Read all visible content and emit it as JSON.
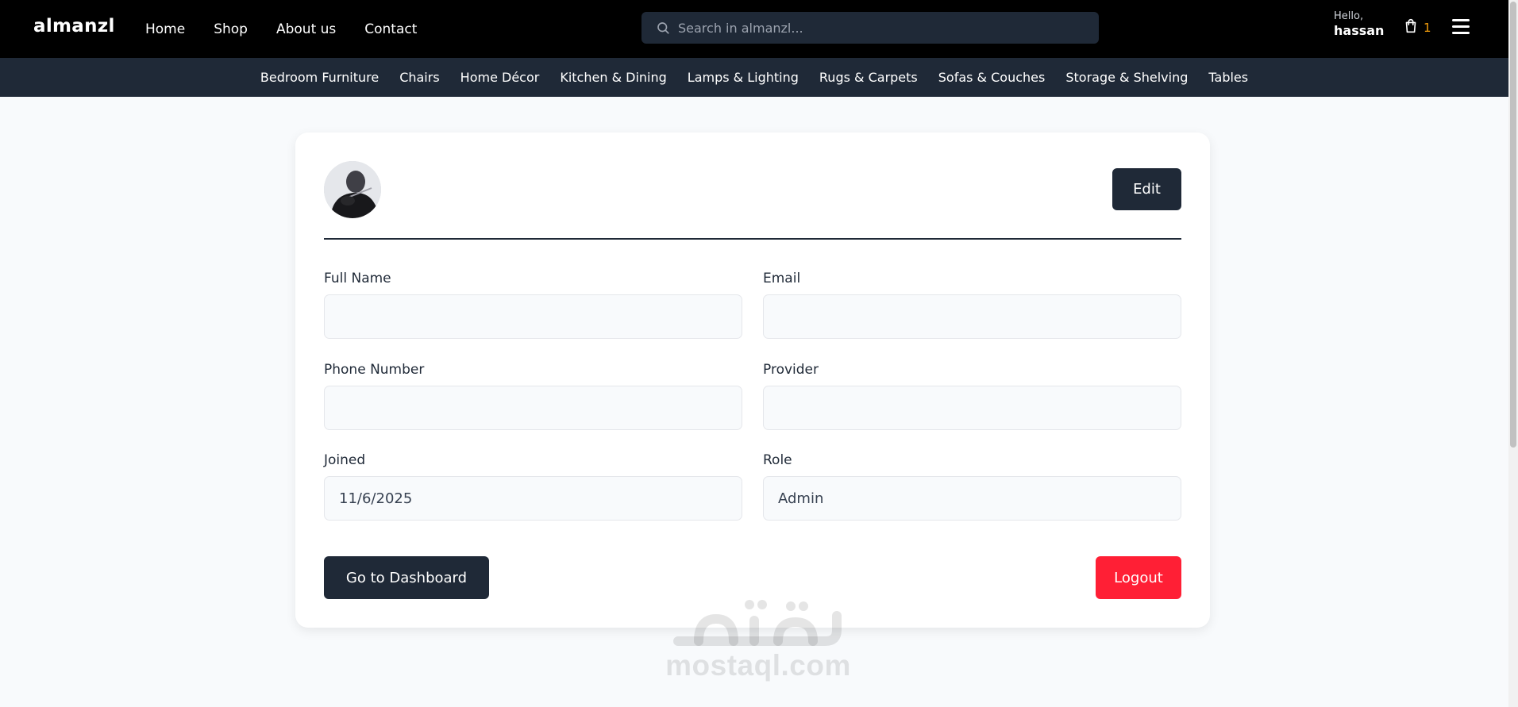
{
  "header": {
    "logo": "almanzl",
    "nav": [
      "Home",
      "Shop",
      "About us",
      "Contact"
    ],
    "search_placeholder": "Search in almanzl...",
    "greeting": "Hello,",
    "username": "hassan",
    "cart_count": "1"
  },
  "categories": [
    "Bedroom Furniture",
    "Chairs",
    "Home Décor",
    "Kitchen & Dining",
    "Lamps & Lighting",
    "Rugs & Carpets",
    "Sofas & Couches",
    "Storage & Shelving",
    "Tables"
  ],
  "profile": {
    "edit_label": "Edit",
    "fields": {
      "full_name": {
        "label": "Full Name",
        "value": ""
      },
      "email": {
        "label": "Email",
        "value": ""
      },
      "phone": {
        "label": "Phone Number",
        "value": ""
      },
      "provider": {
        "label": "Provider",
        "value": ""
      },
      "joined": {
        "label": "Joined",
        "value": "11/6/2025"
      },
      "role": {
        "label": "Role",
        "value": "Admin"
      }
    },
    "dashboard_label": "Go to Dashboard",
    "logout_label": "Logout"
  },
  "watermark": {
    "text": "mostaql.com"
  },
  "colors": {
    "topbar": "#000000",
    "catbar": "#1f2937",
    "primary_button": "#1f2937",
    "logout_button": "#ff1f35",
    "cart_count": "#f59e0b"
  },
  "icons": [
    "search-icon",
    "cart-icon",
    "hamburger-menu-icon"
  ]
}
